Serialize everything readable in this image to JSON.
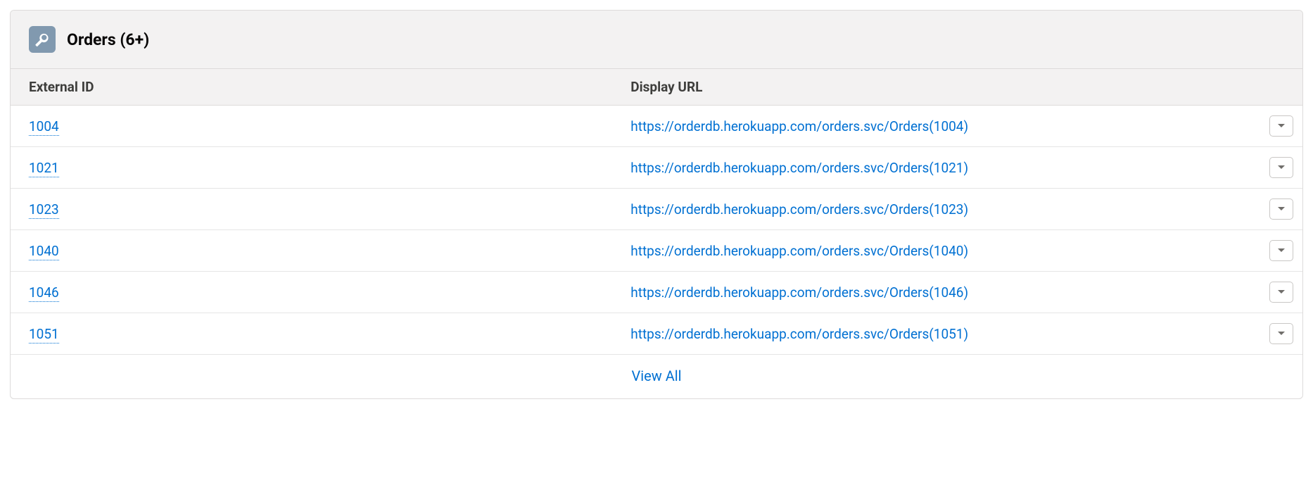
{
  "panel": {
    "title": "Orders (6+)",
    "columns": {
      "external_id": "External ID",
      "display_url": "Display URL"
    },
    "rows": [
      {
        "external_id": "1004",
        "display_url": "https://orderdb.herokuapp.com/orders.svc/Orders(1004)"
      },
      {
        "external_id": "1021",
        "display_url": "https://orderdb.herokuapp.com/orders.svc/Orders(1021)"
      },
      {
        "external_id": "1023",
        "display_url": "https://orderdb.herokuapp.com/orders.svc/Orders(1023)"
      },
      {
        "external_id": "1040",
        "display_url": "https://orderdb.herokuapp.com/orders.svc/Orders(1040)"
      },
      {
        "external_id": "1046",
        "display_url": "https://orderdb.herokuapp.com/orders.svc/Orders(1046)"
      },
      {
        "external_id": "1051",
        "display_url": "https://orderdb.herokuapp.com/orders.svc/Orders(1051)"
      }
    ],
    "view_all": "View All"
  }
}
